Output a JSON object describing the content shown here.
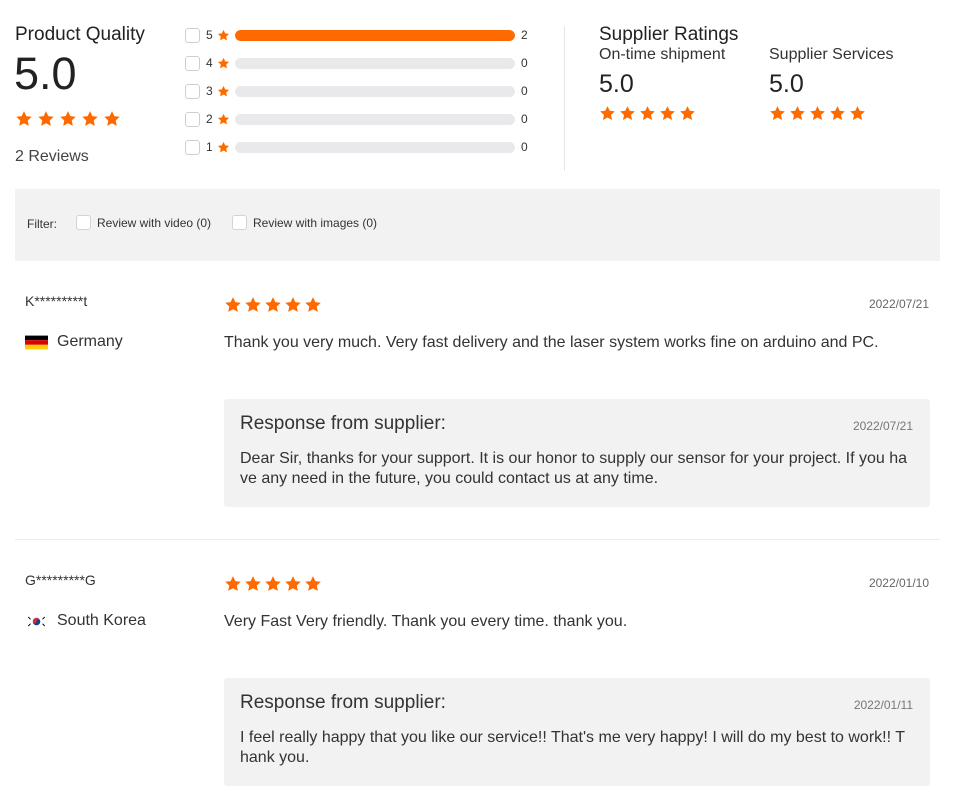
{
  "product_quality": {
    "title": "Product Quality",
    "score": "5.0",
    "stars": 5,
    "reviews_label": "2 Reviews",
    "histogram": [
      {
        "star": "5",
        "count": "2",
        "fraction": 1.0
      },
      {
        "star": "4",
        "count": "0",
        "fraction": 0.0
      },
      {
        "star": "3",
        "count": "0",
        "fraction": 0.0
      },
      {
        "star": "2",
        "count": "0",
        "fraction": 0.0
      },
      {
        "star": "1",
        "count": "0",
        "fraction": 0.0
      }
    ]
  },
  "supplier_ratings": {
    "title": "Supplier Ratings",
    "items": [
      {
        "label": "On-time shipment",
        "score": "5.0",
        "stars": 5
      },
      {
        "label": "Supplier Services",
        "score": "5.0",
        "stars": 5
      }
    ]
  },
  "filter": {
    "label": "Filter:",
    "options": [
      {
        "label": "Review with video (0)"
      },
      {
        "label": "Review with images (0)"
      }
    ]
  },
  "reviews": [
    {
      "user": "K*********t",
      "country": "Germany",
      "flag": "germany-flag-icon",
      "stars": 5,
      "date": "2022/07/21",
      "text": "Thank you very much. Very fast delivery and the laser system works fine on arduino and PC.",
      "response": {
        "title": "Response from supplier:",
        "date": "2022/07/21",
        "text": "Dear Sir, thanks for your support. It is our honor to supply our sensor for your project. If you have any need in the future, you could contact us at any time."
      }
    },
    {
      "user": "G*********G",
      "country": "South Korea",
      "flag": "south-korea-flag-icon",
      "stars": 5,
      "date": "2022/01/10",
      "text": "Very Fast Very friendly. Thank you every time. thank you.",
      "response": {
        "title": "Response from supplier:",
        "date": "2022/01/11",
        "text": "I feel really happy that you like our service!! That's me very happy! I will do my best to work!! Thank you."
      }
    }
  ],
  "colors": {
    "accent": "#ff6a00",
    "track": "#e9e9ec",
    "panel": "#f2f2f2"
  }
}
